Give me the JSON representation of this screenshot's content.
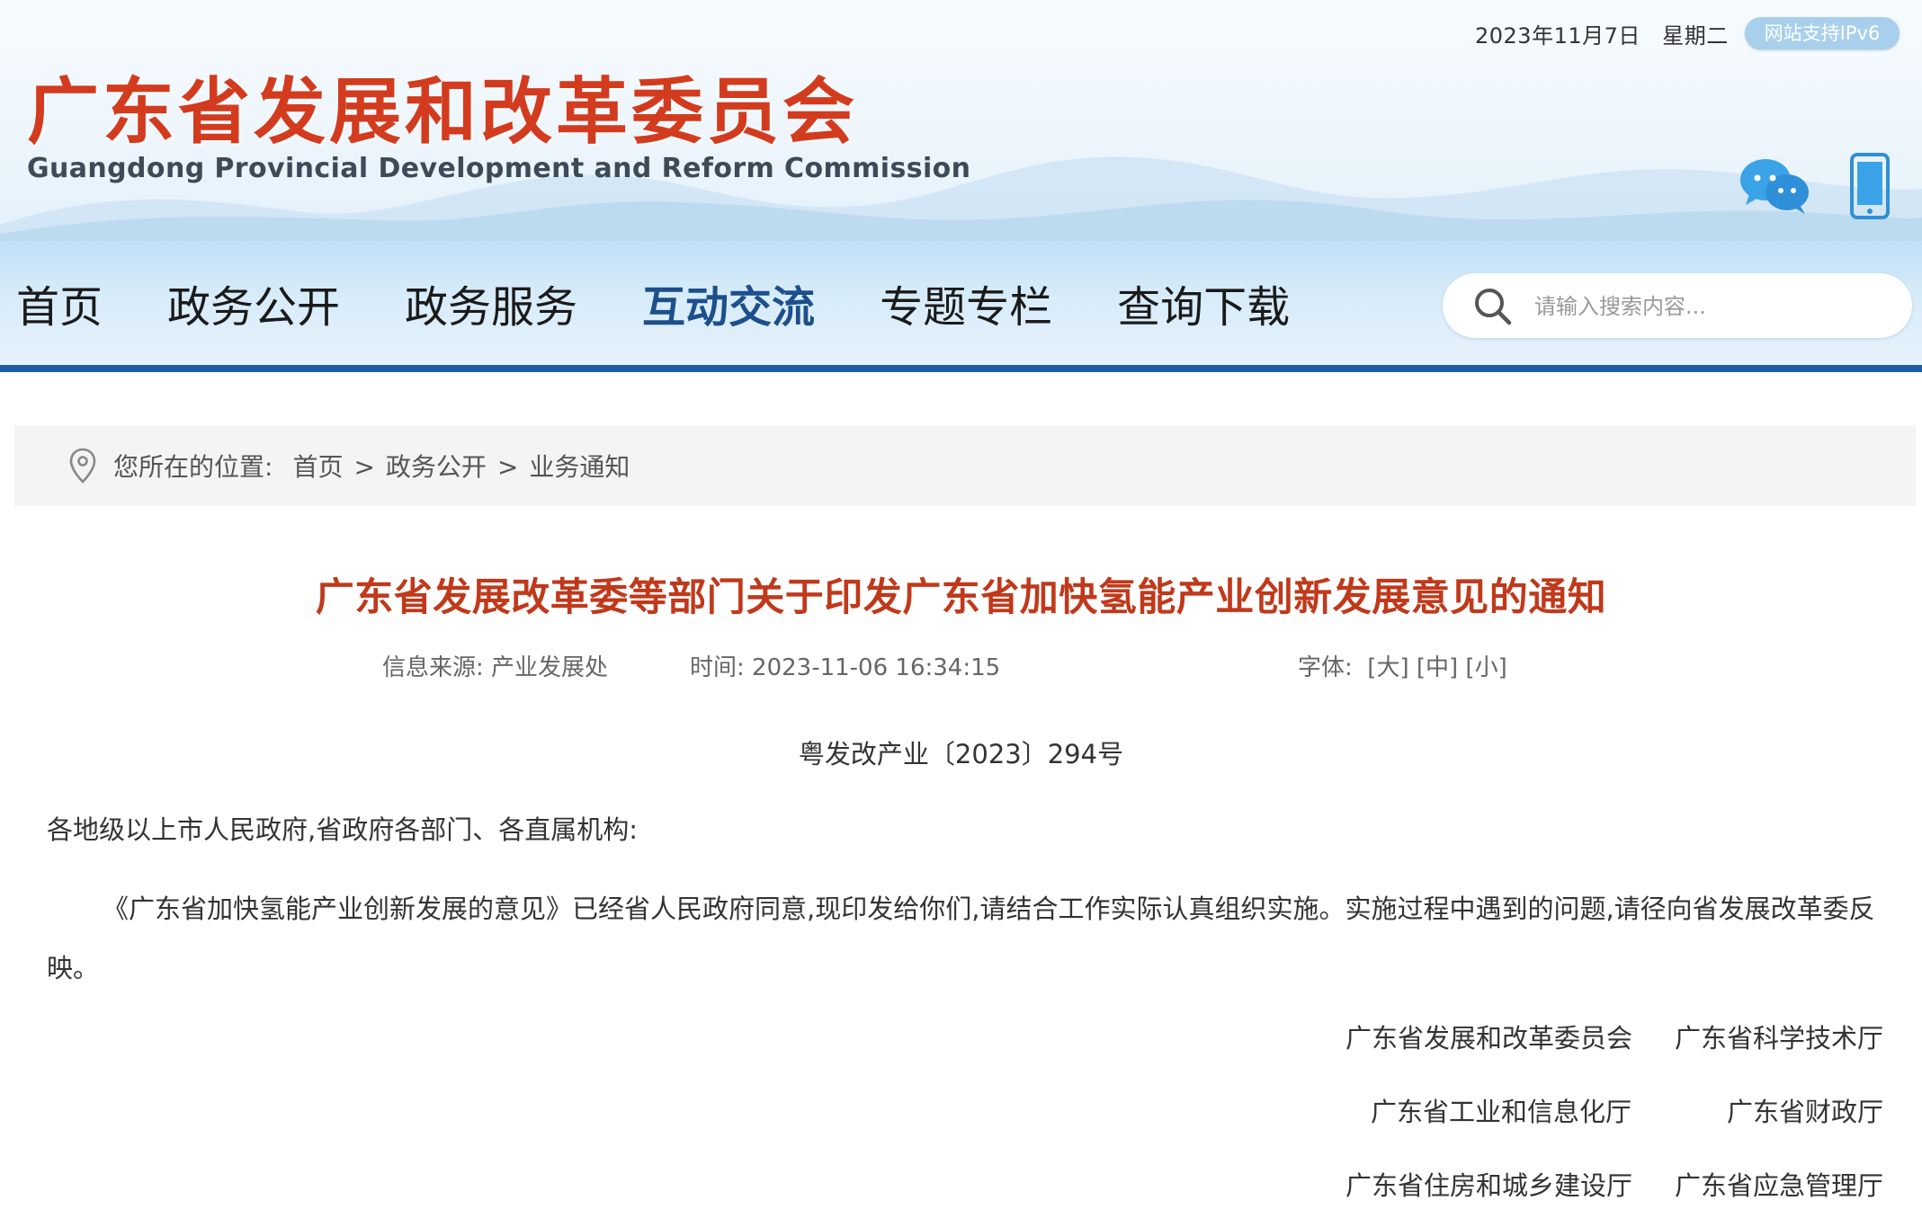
{
  "header": {
    "date": "2023年11月7日",
    "weekday": "星期二",
    "ipv6_badge": "网站支持IPv6",
    "logo_cn": "广东省发展和改革委员会",
    "logo_en": "Guangdong Provincial Development and Reform Commission",
    "icons": [
      "wechat-icon",
      "mobile-icon"
    ]
  },
  "nav": {
    "items": [
      {
        "label": "首页"
      },
      {
        "label": "政务公开"
      },
      {
        "label": "政务服务"
      },
      {
        "label": "互动交流",
        "active": true
      },
      {
        "label": "专题专栏"
      },
      {
        "label": "查询下载"
      }
    ],
    "search_placeholder": "请输入搜索内容..."
  },
  "breadcrumb": {
    "label": "您所在的位置:",
    "items": [
      "首页",
      "政务公开",
      "业务通知"
    ],
    "separator": ">"
  },
  "article": {
    "title": "广东省发展改革委等部门关于印发广东省加快氢能产业创新发展意见的通知",
    "source_label": "信息来源:",
    "source": "产业发展处",
    "time_label": "时间:",
    "time": "2023-11-06 16:34:15",
    "font_label": "字体:",
    "font_large": "[大]",
    "font_medium": "[中]",
    "font_small": "[小]",
    "doc_number": "粤发改产业〔2023〕294号",
    "salutation": "各地级以上市人民政府,省政府各部门、各直属机构:",
    "body": "《广东省加快氢能产业创新发展的意见》已经省人民政府同意,现印发给你们,请结合工作实际认真组织实施。实施过程中遇到的问题,请径向省发展改革委反映。",
    "signatories": [
      "广东省发展和改革委员会",
      "广东省科学技术厅",
      "广东省工业和信息化厅",
      "广东省财政厅",
      "广东省住房和城乡建设厅",
      "广东省应急管理厅"
    ]
  },
  "colors": {
    "title_red": "#c0391b",
    "logo_red": "#d33b1f",
    "nav_active": "#1c4f8c",
    "nav_border": "#1f5ea7"
  }
}
